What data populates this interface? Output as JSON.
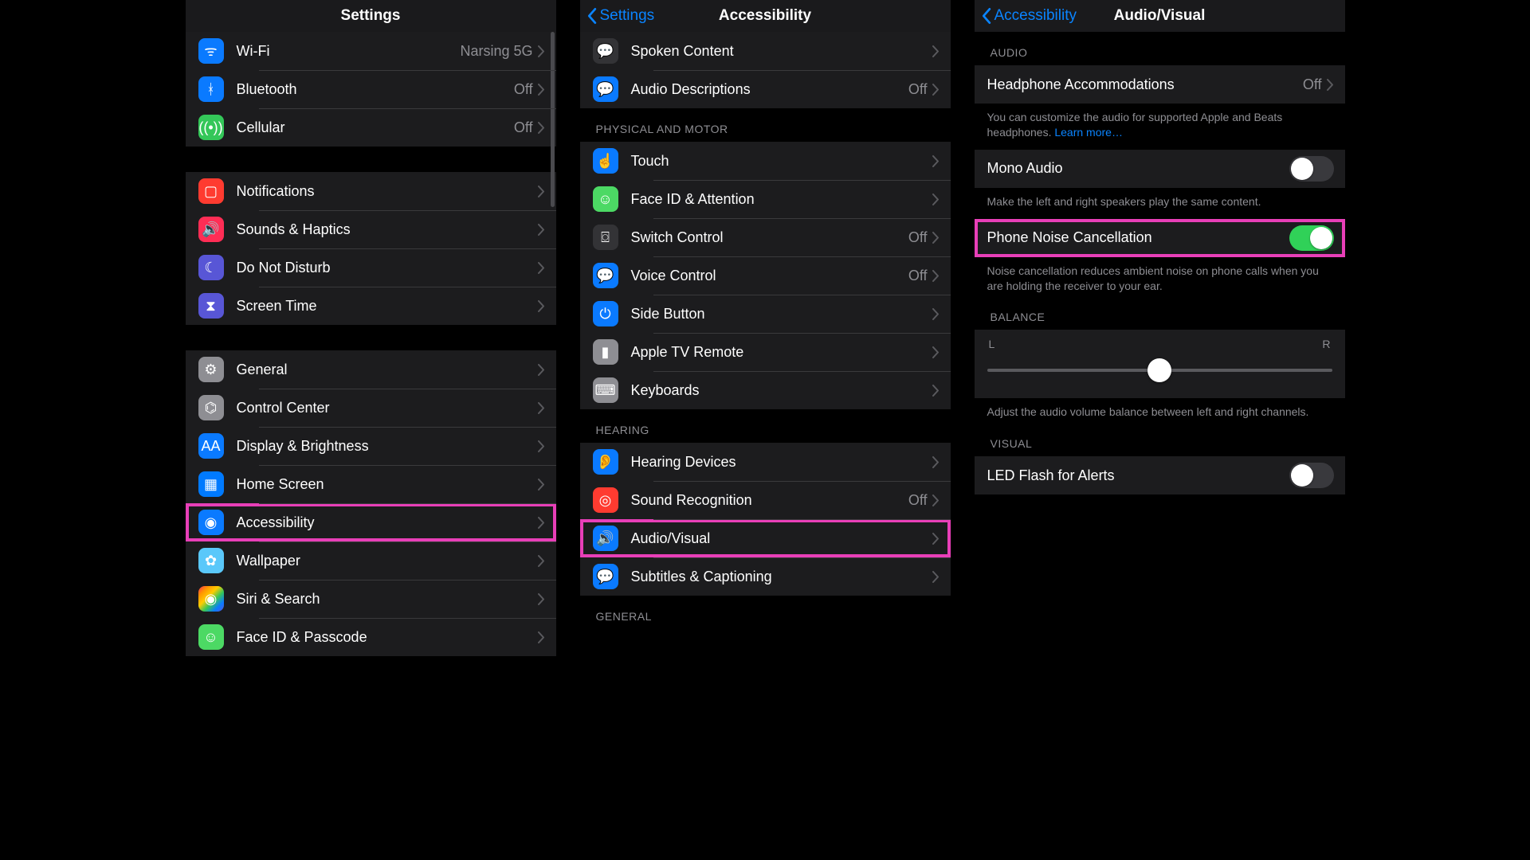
{
  "panes": {
    "settings": {
      "title": "Settings",
      "groups": [
        {
          "items": [
            {
              "icon": "wifi",
              "color": "c-blue",
              "label": "Wi-Fi",
              "value": "Narsing 5G"
            },
            {
              "icon": "bt",
              "color": "c-blue",
              "label": "Bluetooth",
              "value": "Off"
            },
            {
              "icon": "antenna",
              "color": "c-green",
              "label": "Cellular",
              "value": "Off"
            }
          ]
        },
        {
          "items": [
            {
              "icon": "bell",
              "color": "c-red",
              "label": "Notifications"
            },
            {
              "icon": "speaker",
              "color": "c-pink",
              "label": "Sounds & Haptics"
            },
            {
              "icon": "moon",
              "color": "c-purple",
              "label": "Do Not Disturb"
            },
            {
              "icon": "hourglass",
              "color": "c-purple",
              "label": "Screen Time"
            }
          ]
        },
        {
          "items": [
            {
              "icon": "gear",
              "color": "c-grey",
              "label": "General"
            },
            {
              "icon": "switches",
              "color": "c-grey",
              "label": "Control Center"
            },
            {
              "icon": "aa",
              "color": "c-blue",
              "label": "Display & Brightness"
            },
            {
              "icon": "grid",
              "color": "c-blue2",
              "label": "Home Screen"
            },
            {
              "icon": "access",
              "color": "c-blue",
              "label": "Accessibility",
              "highlight": true
            },
            {
              "icon": "flower",
              "color": "c-teal",
              "label": "Wallpaper"
            },
            {
              "icon": "siri",
              "color": "c-multicolor",
              "label": "Siri & Search"
            },
            {
              "icon": "face",
              "color": "c-bgreen",
              "label": "Face ID & Passcode"
            }
          ]
        }
      ]
    },
    "accessibility": {
      "back": "Settings",
      "title": "Accessibility",
      "groups": [
        {
          "items": [
            {
              "icon": "bubble",
              "color": "c-dark",
              "label": "Spoken Content"
            },
            {
              "icon": "ad",
              "color": "c-blue",
              "label": "Audio Descriptions",
              "value": "Off"
            }
          ]
        },
        {
          "header": "PHYSICAL AND MOTOR",
          "items": [
            {
              "icon": "point",
              "color": "c-blue",
              "label": "Touch"
            },
            {
              "icon": "smile",
              "color": "c-bgreen",
              "label": "Face ID & Attention"
            },
            {
              "icon": "switch",
              "color": "c-dark",
              "label": "Switch Control",
              "value": "Off"
            },
            {
              "icon": "voice",
              "color": "c-blue",
              "label": "Voice Control",
              "value": "Off"
            },
            {
              "icon": "power",
              "color": "c-blue",
              "label": "Side Button"
            },
            {
              "icon": "remote",
              "color": "c-grey",
              "label": "Apple TV Remote"
            },
            {
              "icon": "kbd",
              "color": "c-grey",
              "label": "Keyboards"
            }
          ]
        },
        {
          "header": "HEARING",
          "items": [
            {
              "icon": "ear",
              "color": "c-blue",
              "label": "Hearing Devices"
            },
            {
              "icon": "sound",
              "color": "c-red",
              "label": "Sound Recognition",
              "value": "Off"
            },
            {
              "icon": "av",
              "color": "c-blue",
              "label": "Audio/Visual",
              "highlight": true
            },
            {
              "icon": "cc",
              "color": "c-blue",
              "label": "Subtitles & Captioning"
            }
          ]
        },
        {
          "header": "GENERAL",
          "items": []
        }
      ]
    },
    "audiovisual": {
      "back": "Accessibility",
      "title": "Audio/Visual",
      "sections": {
        "audio_header": "AUDIO",
        "headphone": {
          "label": "Headphone Accommodations",
          "value": "Off"
        },
        "headphone_footer": "You can customize the audio for supported Apple and Beats headphones. ",
        "headphone_link": "Learn more…",
        "mono": {
          "label": "Mono Audio",
          "on": false
        },
        "mono_footer": "Make the left and right speakers play the same content.",
        "noise": {
          "label": "Phone Noise Cancellation",
          "on": true,
          "highlight": true
        },
        "noise_footer": "Noise cancellation reduces ambient noise on phone calls when you are holding the receiver to your ear.",
        "balance_header": "BALANCE",
        "balance_left": "L",
        "balance_right": "R",
        "balance_footer": "Adjust the audio volume balance between left and right channels.",
        "visual_header": "VISUAL",
        "led": {
          "label": "LED Flash for Alerts",
          "on": false
        }
      }
    }
  },
  "icon_glyphs": {
    "wifi": "ᯤ",
    "bt": "ᚼ",
    "antenna": "((•))",
    "bell": "▢",
    "speaker": "🔊",
    "moon": "☾",
    "hourglass": "⧗",
    "gear": "⚙",
    "switches": "⌬",
    "aa": "AA",
    "grid": "▦",
    "access": "◉",
    "flower": "✿",
    "siri": "◉",
    "face": "☺",
    "bubble": "💬",
    "ad": "💬",
    "point": "☝",
    "smile": "☺",
    "switch": "⌼",
    "voice": "💬",
    "power": "⏻",
    "remote": "▮",
    "kbd": "⌨",
    "ear": "👂",
    "sound": "◎",
    "av": "🔊",
    "cc": "💬"
  }
}
